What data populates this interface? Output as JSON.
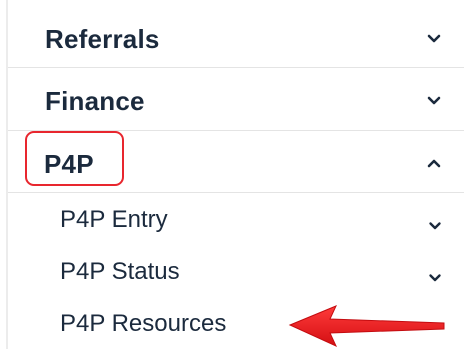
{
  "sidebar": {
    "sections": [
      {
        "label": "Referrals",
        "expanded": false,
        "icon": "chevron-down-icon"
      },
      {
        "label": "Finance",
        "expanded": false,
        "icon": "chevron-down-icon"
      },
      {
        "label": "P4P",
        "expanded": true,
        "icon": "chevron-up-icon"
      }
    ],
    "p4p_items": [
      {
        "label": "P4P Entry",
        "icon": "chevron-down-icon"
      },
      {
        "label": "P4P Status",
        "icon": "chevron-down-icon"
      },
      {
        "label": "P4P Resources"
      }
    ]
  },
  "annotations": {
    "highlight_color": "#e8262e",
    "arrow_icon": "red-arrow-icon"
  }
}
